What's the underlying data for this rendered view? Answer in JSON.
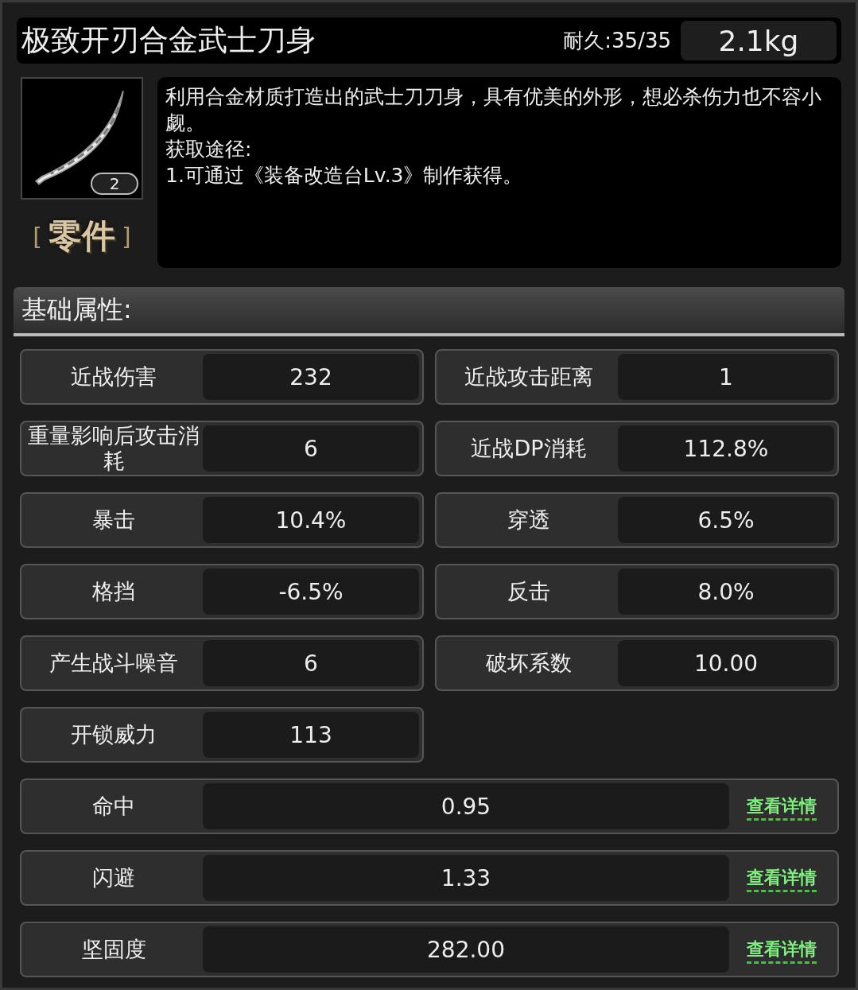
{
  "item": {
    "name": "极致开刃合金武士刀身",
    "durability": "耐久:35/35",
    "weight": "2.1kg",
    "count": "2",
    "category_open": "[",
    "category": "零件",
    "category_close": "]",
    "description": [
      "利用合金材质打造出的武士刀刀身，具有优美的外形，想必杀伤力也不容小觑。",
      "获取途径:",
      "1.可通过《装备改造台Lv.3》制作获得。"
    ]
  },
  "section": {
    "title": "基础属性:"
  },
  "stats": [
    {
      "kind": "half",
      "label": "近战伤害",
      "value": "232"
    },
    {
      "kind": "half",
      "label": "近战攻击距离",
      "value": "1"
    },
    {
      "kind": "half",
      "label": "重量影响后攻击消耗",
      "value": "6"
    },
    {
      "kind": "half",
      "label": "近战DP消耗",
      "value": "112.8%"
    },
    {
      "kind": "half",
      "label": "暴击",
      "value": "10.4%"
    },
    {
      "kind": "half",
      "label": "穿透",
      "value": "6.5%"
    },
    {
      "kind": "half",
      "label": "格挡",
      "value": "-6.5%"
    },
    {
      "kind": "half",
      "label": "反击",
      "value": "8.0%"
    },
    {
      "kind": "half",
      "label": "产生战斗噪音",
      "value": "6"
    },
    {
      "kind": "half",
      "label": "破坏系数",
      "value": "10.00"
    },
    {
      "kind": "half",
      "label": "开锁威力",
      "value": "113"
    },
    {
      "kind": "full",
      "label": "命中",
      "value": "0.95",
      "link": "查看详情"
    },
    {
      "kind": "full",
      "label": "闪避",
      "value": "1.33",
      "link": "查看详情"
    },
    {
      "kind": "full",
      "label": "坚固度",
      "value": "282.00",
      "link": "查看详情"
    }
  ]
}
